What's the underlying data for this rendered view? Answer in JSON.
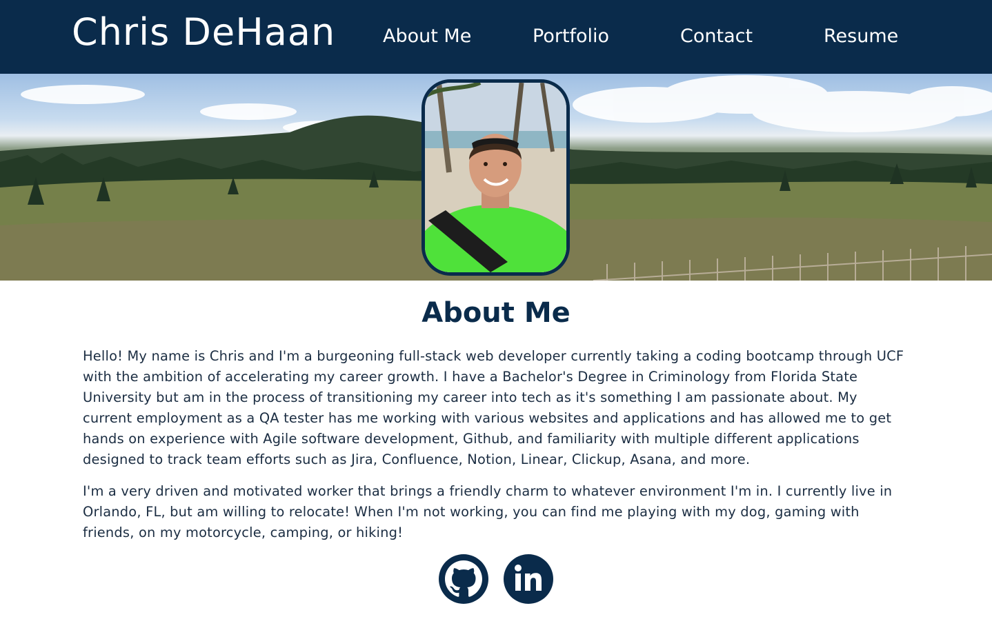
{
  "header": {
    "brand": "Chris DeHaan",
    "nav": {
      "about": "About Me",
      "portfolio": "Portfolio",
      "contact": "Contact",
      "resume": "Resume"
    }
  },
  "about": {
    "title": "About Me",
    "paragraph_1": "Hello! My name is Chris and I'm a burgeoning full-stack web developer currently taking a coding bootcamp through UCF with the ambition of accelerating my career growth. I have a Bachelor's Degree in Criminology from Florida State University but am in the process of transitioning my career into tech as it's something I am passionate about. My current employment as a QA tester has me working with various websites and applications and has allowed me to get hands on experience with Agile software development, Github, and familiarity with multiple different applications designed to track team efforts such as Jira, Confluence, Notion, Linear, Clickup, Asana, and more.",
    "paragraph_2": "I'm a very driven and motivated worker that brings a friendly charm to whatever environment I'm in. I currently live in Orlando, FL, but am willing to relocate! When I'm not working, you can find me playing with my dog, gaming with friends, on my motorcycle, camping, or hiking!"
  },
  "social": {
    "github_icon": "github-icon",
    "linkedin_icon": "linkedin-icon",
    "linkedin_text": "in"
  },
  "colors": {
    "navy": "#0a2b4b",
    "text": "#1b2d42",
    "white": "#ffffff"
  }
}
